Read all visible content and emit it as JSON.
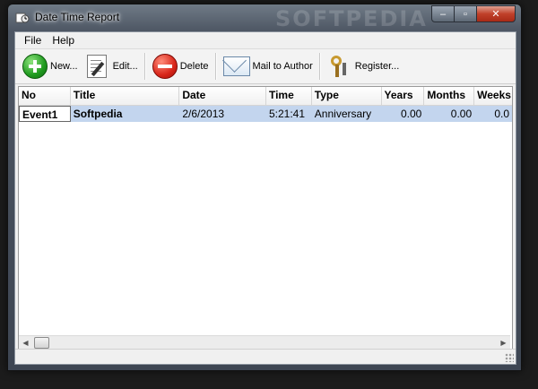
{
  "window": {
    "title": "Date Time Report",
    "watermark": "SOFTPEDIA",
    "controls": {
      "minimize": "‒",
      "maximize": "▫",
      "close": "✕"
    }
  },
  "menu": [
    "File",
    "Help"
  ],
  "toolbar": {
    "new_label": "New...",
    "edit_label": "Edit...",
    "delete_label": "Delete",
    "mail_label": "Mail to Author",
    "register_label": "Register..."
  },
  "table": {
    "columns": [
      "No",
      "Title",
      "Date",
      "Time",
      "Type",
      "Years",
      "Months",
      "Weeks"
    ],
    "rows": [
      {
        "no": "Event1",
        "title": "Softpedia",
        "date": "2/6/2013",
        "time": "5:21:41",
        "type": "Anniversary",
        "years": "0.00",
        "months": "0.00",
        "weeks": "0.0"
      }
    ]
  },
  "icons": {
    "app": "app-icon",
    "new": "add-icon",
    "edit": "edit-document-icon",
    "delete": "delete-icon",
    "mail": "envelope-icon",
    "register": "keys-icon"
  },
  "colors": {
    "selected_row": "#c3d5ee",
    "close_button": "#c0402a",
    "new_icon": "#1f9a1f",
    "delete_icon": "#d8261a"
  }
}
